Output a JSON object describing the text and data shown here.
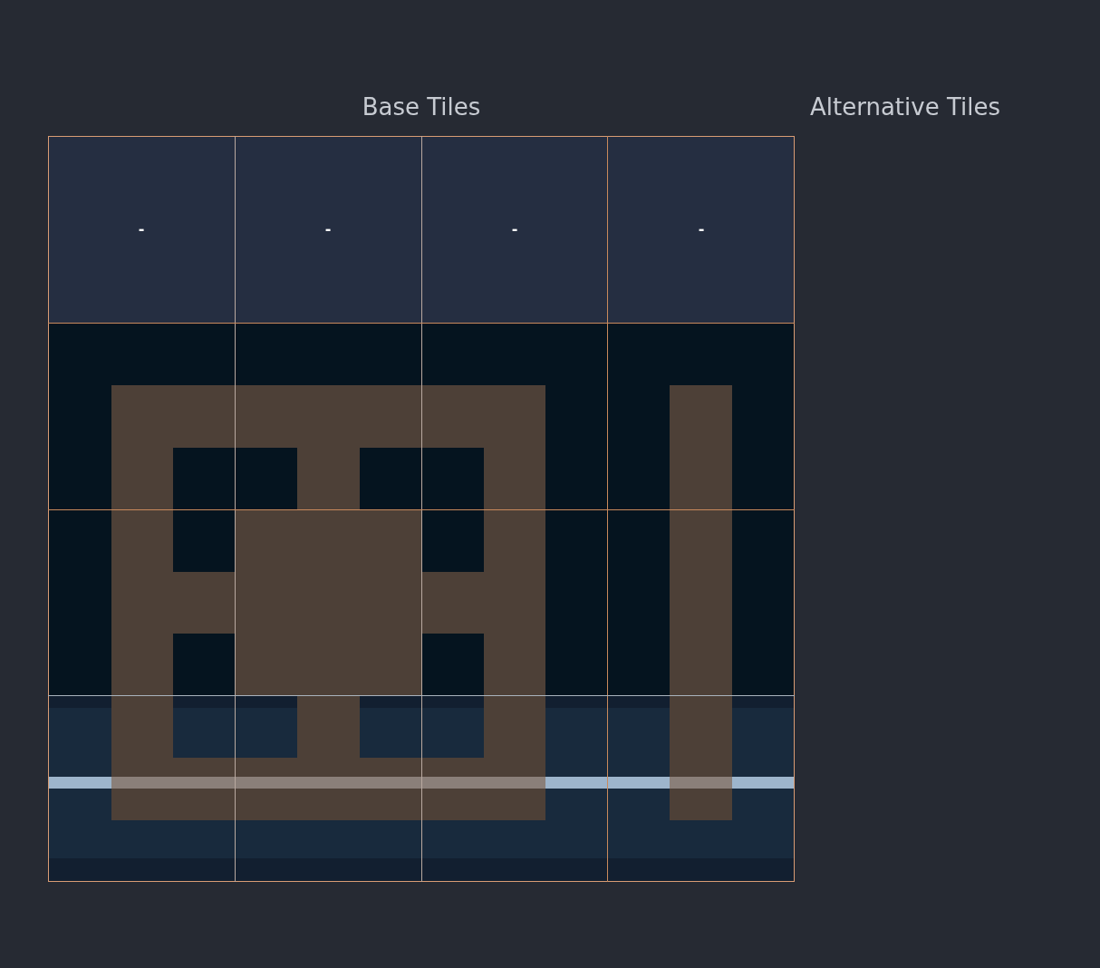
{
  "base_tiles": {
    "title": "Base Tiles",
    "tiles": [
      {
        "label": "-"
      },
      {
        "label": "-"
      },
      {
        "label": "-"
      },
      {
        "label": "-"
      }
    ]
  },
  "alternative_tiles": {
    "title": "Alternative Tiles"
  }
}
